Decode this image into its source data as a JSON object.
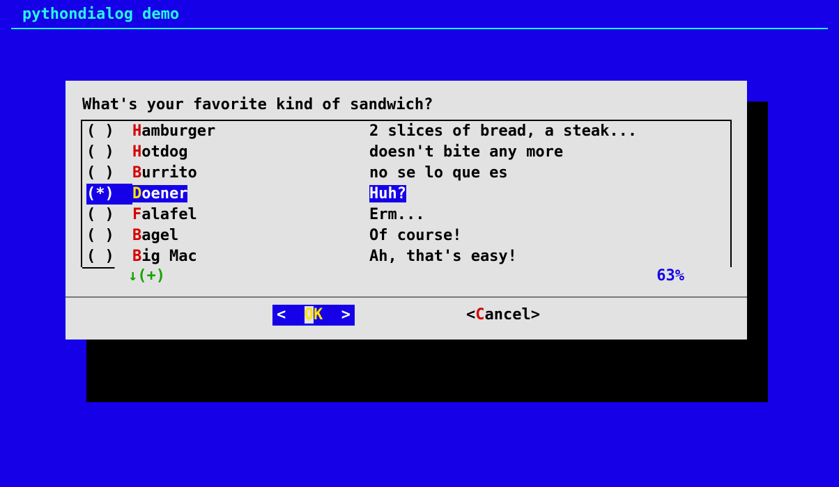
{
  "title": "pythondialog demo",
  "dialog": {
    "prompt": "What's your favorite kind of sandwich?",
    "items": [
      {
        "checked": false,
        "selected": false,
        "hot": "H",
        "rest": "amburger",
        "desc": "2 slices of bread, a steak..."
      },
      {
        "checked": false,
        "selected": false,
        "hot": "H",
        "rest": "otdog",
        "desc": "doesn't bite any more"
      },
      {
        "checked": false,
        "selected": false,
        "hot": "B",
        "rest": "urrito",
        "desc": "no se lo que es"
      },
      {
        "checked": true,
        "selected": true,
        "hot": "D",
        "rest": "oener",
        "desc": "Huh?"
      },
      {
        "checked": false,
        "selected": false,
        "hot": "F",
        "rest": "alafel",
        "desc": "Erm..."
      },
      {
        "checked": false,
        "selected": false,
        "hot": "B",
        "rest": "agel",
        "desc": "Of course!"
      },
      {
        "checked": false,
        "selected": false,
        "hot": "B",
        "rest": "ig Mac",
        "desc": "Ah, that's easy!"
      }
    ],
    "more_indicator": "↓(+)",
    "percent": "63%",
    "buttons": {
      "ok": {
        "lt": "<  ",
        "hot": "O",
        "rest": "K",
        "gt": "  >"
      },
      "cancel": {
        "lt": "<",
        "hot": "C",
        "rest": "ancel",
        "gt": ">"
      }
    }
  }
}
